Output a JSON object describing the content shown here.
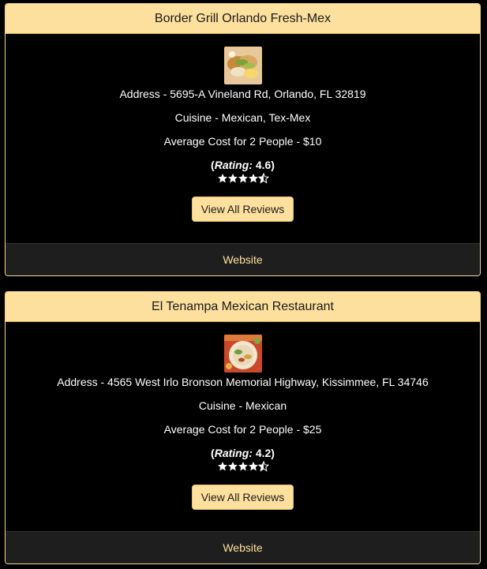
{
  "restaurants": [
    {
      "name": "Border Grill Orlando Fresh-Mex",
      "address_label": "Address - 5695-A Vineland Rd, Orlando, FL 32819",
      "cuisine_label": "Cuisine - Mexican, Tex-Mex",
      "cost_label": "Average Cost for 2 People - $10",
      "rating_word": "Rating:",
      "rating_value": "4.6",
      "rating_stars": 4.5,
      "reviews_button": "View All Reviews",
      "website_link": "Website"
    },
    {
      "name": "El Tenampa Mexican Restaurant",
      "address_label": "Address - 4565 West Irlo Bronson Memorial Highway, Kissimmee, FL 34746",
      "cuisine_label": "Cuisine - Mexican",
      "cost_label": "Average Cost for 2 People - $25",
      "rating_word": "Rating:",
      "rating_value": "4.2",
      "rating_stars": 4.5,
      "reviews_button": "View All Reviews",
      "website_link": "Website"
    }
  ],
  "colors": {
    "header_bg": "#fde09e",
    "border": "#f5d88a",
    "footer_bg": "#1e1e1e",
    "link": "#fde09e"
  },
  "icons": {
    "star_full": "star-icon",
    "star_half": "half-star-icon"
  }
}
